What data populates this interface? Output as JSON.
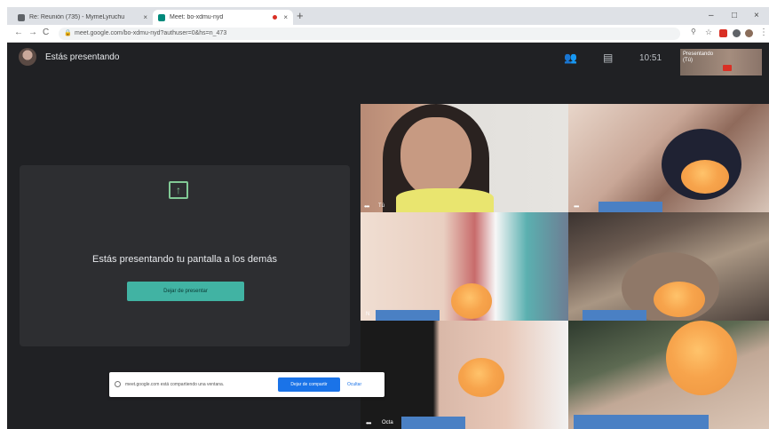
{
  "browser": {
    "tabs": [
      {
        "title": "Re: Reunión (735) - MymeLyruchu",
        "favicon_color": "#5f6368"
      },
      {
        "title": "Meet: bo-xdmu-nyd",
        "favicon_color": "#00897b"
      }
    ],
    "new_tab": "+",
    "window_controls": [
      "–",
      "□",
      "×"
    ],
    "nav": {
      "back": "←",
      "forward": "→",
      "reload": "C"
    },
    "url": "meet.google.com/bo-xdmu-nyd?authuser=0&hs=n_473"
  },
  "meet": {
    "header_title": "Estás presentando",
    "clock": "10:51",
    "self_preview_label": "Presentando (Tú)",
    "panel": {
      "message": "Estás presentando tu pantalla a los demás",
      "stop_button": "Dejar de presentar"
    },
    "tiles": [
      {
        "name": "Tú"
      },
      {
        "name": ""
      },
      {
        "name": "N"
      },
      {
        "name": ""
      },
      {
        "name": "Octa"
      },
      {
        "name": ""
      }
    ],
    "share_bar": {
      "text": "meet.google.com está compartiendo una ventana.",
      "stop_label": "Dejar de compartir",
      "hide_label": "Ocultar"
    }
  },
  "colors": {
    "meet_bg": "#202124",
    "panel_bg": "#2d2e31",
    "accent": "#41b3a3",
    "redact_box": "#4a80c4",
    "blur_blob": "#f7a44c",
    "chrome_blue": "#1a73e8"
  }
}
